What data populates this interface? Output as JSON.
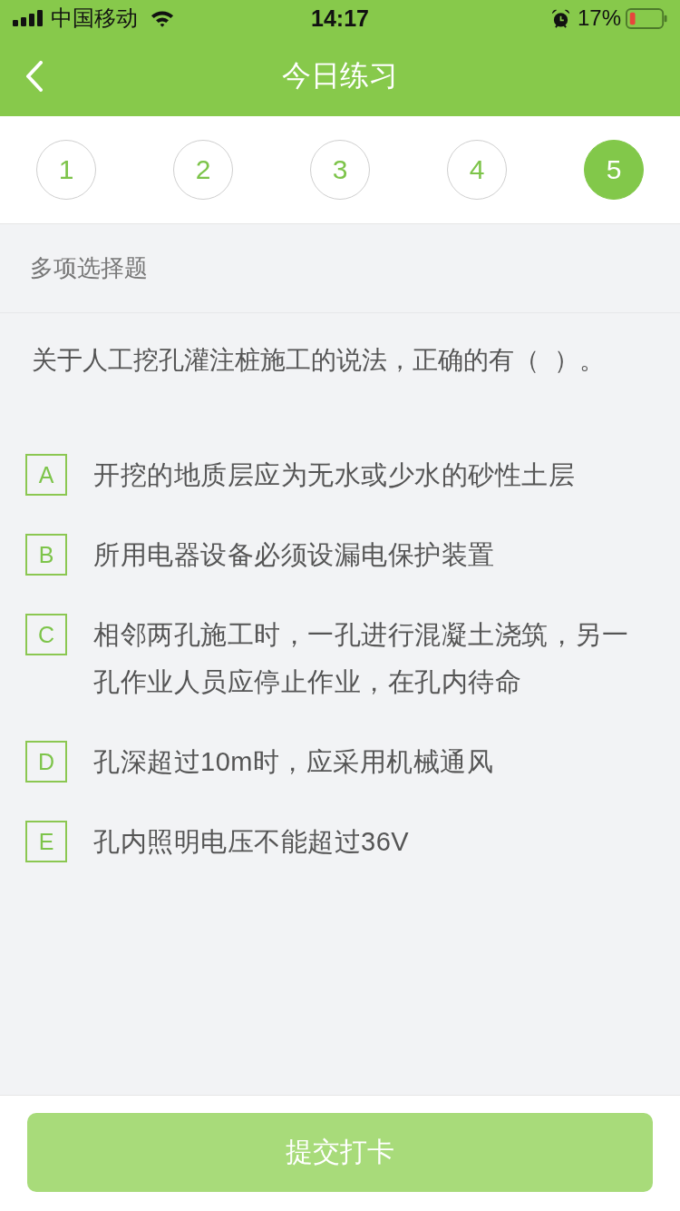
{
  "status_bar": {
    "carrier": "中国移动",
    "time": "14:17",
    "battery": "17%"
  },
  "nav_bar": {
    "title": "今日练习"
  },
  "questions": [
    {
      "label": "1",
      "selected": false
    },
    {
      "label": "2",
      "selected": false
    },
    {
      "label": "3",
      "selected": false
    },
    {
      "label": "4",
      "selected": false
    },
    {
      "label": "5",
      "selected": true
    }
  ],
  "section": {
    "title": "多项选择题"
  },
  "question": {
    "text": "关于人工挖孔灌注桩施工的说法，正确的有（  ）。",
    "options": [
      {
        "letter": "A",
        "text": "开挖的地质层应为无水或少水的砂性土层",
        "selected": false
      },
      {
        "letter": "B",
        "text": "所用电器设备必须设漏电保护装置",
        "selected": false
      },
      {
        "letter": "C",
        "text": "相邻两孔施工时，一孔进行混凝土浇筑，另一孔作业人员应停止作业，在孔内待命",
        "selected": false
      },
      {
        "letter": "D",
        "text": "孔深超过10m时，应采用机械通风",
        "selected": false
      },
      {
        "letter": "E",
        "text": "孔内照明电压不能超过36V",
        "selected": false
      }
    ]
  },
  "submit_button": {
    "label": "提交打卡",
    "disabled": true
  }
}
